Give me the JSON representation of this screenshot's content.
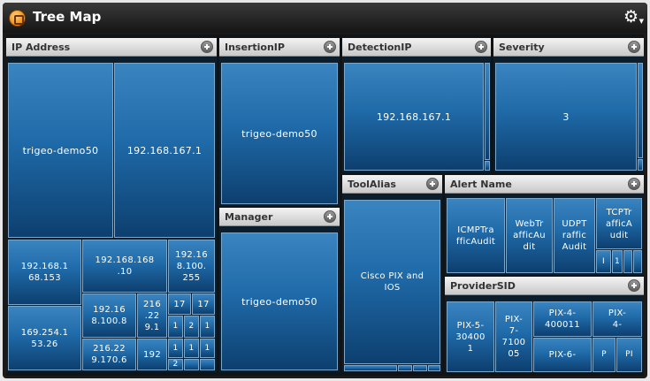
{
  "app": {
    "title": "Tree Map",
    "icon": "treemap-app-icon",
    "settings_icon": "gear-icon"
  },
  "panels": {
    "ip_address": {
      "title": "IP Address",
      "cells": [
        "trigeo-demo50",
        "192.168.167.1",
        "192.168.1\n68.153",
        "192.168.168\n.10",
        "192.16\n8.100.\n255",
        "169.254.1\n53.26",
        "192.16\n8.100.8",
        "216\n.22\n9.1",
        "17",
        "17",
        "1",
        "2",
        "1",
        "216.22\n9.170.6",
        "192",
        "1",
        "1",
        "1",
        "2"
      ]
    },
    "insertion_ip": {
      "title": "InsertionIP",
      "cells": [
        "trigeo-demo50"
      ]
    },
    "manager": {
      "title": "Manager",
      "cells": [
        "trigeo-demo50"
      ]
    },
    "detection_ip": {
      "title": "DetectionIP",
      "cells": [
        "192.168.167.1"
      ]
    },
    "severity": {
      "title": "Severity",
      "cells": [
        "3"
      ]
    },
    "tool_alias": {
      "title": "ToolAlias",
      "cells": [
        "Cisco PIX and\nIOS"
      ]
    },
    "alert_name": {
      "title": "Alert Name",
      "cells": [
        "ICMPTra\nfficAudit",
        "WebTr\nafficAu\ndit",
        "UDPT\nraffic\nAudit",
        "TCPTr\nafficA\nudit",
        "I",
        "1"
      ]
    },
    "provider_sid": {
      "title": "ProviderSID",
      "cells": [
        "PIX-5-\n30400\n1",
        "PIX-\n7-\n7100\n05",
        "PIX-4-\n400011",
        "PIX-\n4-",
        "PIX-6-",
        "P",
        "PI"
      ]
    }
  },
  "colors": {
    "cell_top": "#3a84c0",
    "cell_bottom": "#0d3f6f",
    "header": "#d9d9d9",
    "titlebar": "#1f1f1f"
  }
}
